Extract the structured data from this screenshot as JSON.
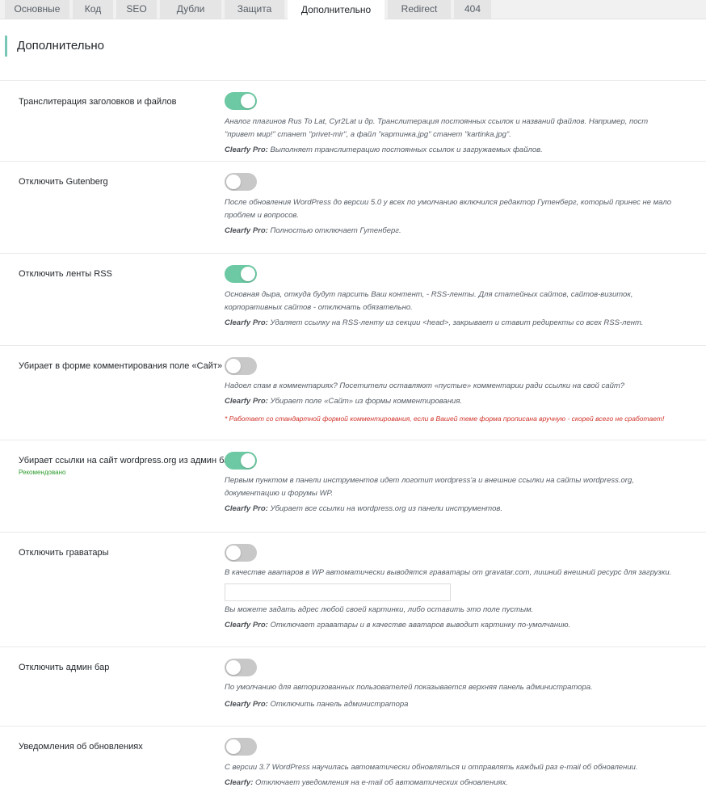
{
  "tabs": [
    {
      "label": "Основные"
    },
    {
      "label": "Код"
    },
    {
      "label": "SEO"
    },
    {
      "label": "Дубли"
    },
    {
      "label": "Защита"
    },
    {
      "label": "Дополнительно"
    },
    {
      "label": "Redirect"
    },
    {
      "label": "404"
    }
  ],
  "active_tab": "Дополнительно",
  "page_title": "Дополнительно",
  "colors": {
    "toggle_on": "#6cc9a3",
    "toggle_off": "#c8c8c8",
    "accent_bar": "#78c7b6",
    "warning": "#d0332b",
    "recommended": "#2e9c2e"
  },
  "settings": [
    {
      "label": "Транслитерация заголовков и файлов",
      "enabled": true,
      "description": "Аналог плагинов Rus To Lat, Cyr2Lat и др. Транслитерация постоянных ссылок и названий файлов. Например, пост \"привет мир!\" станет \"privet-mir\", а файл \"картинка.jpg\" станет \"kartinka.jpg\".",
      "pro_label": "Clearfy Pro:",
      "pro_text": "Выполняет транслитерацию постоянных ссылок и загружаемых файлов."
    },
    {
      "label": "Отключить Gutenberg",
      "enabled": false,
      "description": "После обновления WordPress до версии 5.0 у всех по умолчанию включился редактор Гутенберг, который принес не мало проблем и вопросов.",
      "pro_label": "Clearfy Pro:",
      "pro_text": "Полностью отключает Гутенберг."
    },
    {
      "label": "Отключить ленты RSS",
      "enabled": true,
      "description": "Основная дыра, откуда будут парсить Ваш контент, - RSS-ленты. Для статейных сайтов, сайтов-визиток, корпоративных сайтов - отключать обязательно.",
      "pro_label": "Clearfy Pro:",
      "pro_text": "Удаляет ссылку на RSS-ленту из секции <head>, закрывает и ставит редиректы со всех RSS-лент."
    },
    {
      "label": "Убирает в форме комментирования поле «Сайт»",
      "enabled": false,
      "description": "Надоел спам в комментариях? Посетители оставляют «пустые» комментарии ради ссылки на свой сайт?",
      "pro_label": "Clearfy Pro:",
      "pro_text": "Убирает поле «Сайт» из формы комментирования.",
      "warning": "* Работает со стандартной формой комментирования, если в Вашей теме форма прописана вручную - скорей всего не сработает!"
    },
    {
      "label": "Убирает ссылки на сайт wordpress.org из админ бара",
      "sublabel": "Рекомендовано",
      "enabled": true,
      "description": "Первым пунктом в панели инструментов идет логотип wordpress'а и внешние ссылки на сайты wordpress.org, документацию и форумы WP.",
      "pro_label": "Clearfy Pro:",
      "pro_text": "Убирает все ссылки на wordpress.org из панели инструментов."
    },
    {
      "label": "Отключить граватары",
      "enabled": false,
      "description": "В качестве аватаров в WP автоматически выводятся граватары от gravatar.com, лишний внешний ресурс для загрузки.",
      "input_value": "",
      "input_hint": "Вы можете задать адрес любой своей картинки, либо оставить это поле пустым.",
      "pro_label": "Clearfy Pro:",
      "pro_text": "Отключает граватары и в качестве аватаров выводит картинку по-умолчанию."
    },
    {
      "label": "Отключить админ бар",
      "enabled": false,
      "description": "По умолчанию для авторизованных пользователей показывается верхняя панель администратора.",
      "pro_label": "Clearfy Pro:",
      "pro_text": "Отключить панель администратора"
    },
    {
      "label": "Уведомления об обновлениях",
      "enabled": false,
      "description": "С версии 3.7 WordPress научилась автоматически обновляться и отправлять каждый раз e-mail об обновлении.",
      "pro_label": "Clearfy:",
      "pro_text": "Отключает уведомления на e-mail об автоматических обновлениях."
    }
  ]
}
